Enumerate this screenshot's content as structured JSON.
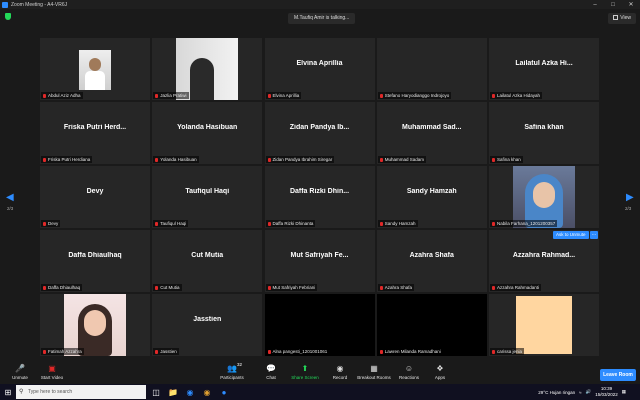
{
  "window": {
    "title": "Zoom Meeting - A4-VR6J"
  },
  "topbar": {
    "talking": "M.Taufiq Amir is talking...",
    "view_label": "View"
  },
  "nav": {
    "page_left": "2/3",
    "page_right": "2/3"
  },
  "participants": [
    {
      "label": "Abdul Aziz Adha",
      "video": "v1"
    },
    {
      "label": "Jazlia Pratiwi",
      "video": "v2"
    },
    {
      "big": "Elvina Aprillia",
      "label": "Elvina Aprillia"
    },
    {
      "big": "",
      "label": "Stefano Haryodianggo Indrojoyo"
    },
    {
      "big": "Lailatul Azka Hi...",
      "label": "Lailatul Azka Hidayah"
    },
    {
      "big": "Friska Putri Herd...",
      "label": "Friska Putri Herdiana"
    },
    {
      "big": "Yolanda Hasibuan",
      "label": "Yolanda Hasibuan"
    },
    {
      "big": "Zidan Pandya Ib...",
      "label": "Zidan Pandya Ibrahim Siregar"
    },
    {
      "big": "Muhammad Sad...",
      "label": "Muhammad Sadam"
    },
    {
      "big": "Safina khan",
      "label": "Safina khan"
    },
    {
      "big": "Devy",
      "label": "Devy"
    },
    {
      "big": "Taufiqul Haqi",
      "label": "Taufiqul Haqi"
    },
    {
      "big": "Daffa Rizki Dhin...",
      "label": "Daffa Rizki Dhinanta"
    },
    {
      "big": "Sandy Hamzah",
      "label": "Sandy Hamzah"
    },
    {
      "label": "Nabila Farhana_1201200357",
      "video": "v3"
    },
    {
      "big": "Daffa Dhiaulhaq",
      "label": "Daffa Dhiaulhaq"
    },
    {
      "big": "Cut Mutia",
      "label": "Cut Mutia"
    },
    {
      "big": "Mut Safriyah Fe...",
      "label": "Mut Safriyah Febriani"
    },
    {
      "big": "Azahra Shafa",
      "label": "Azahra Shafa"
    },
    {
      "big": "Azzahra Rahmad...",
      "label": "Azzahra Rahmadanti"
    },
    {
      "label": "Fatimah Azzahra",
      "video": "v4"
    },
    {
      "big": "Jasstien",
      "label": "Jasstien"
    },
    {
      "label": "Alna pangesti_1201001061",
      "black": true
    },
    {
      "label": "Lawren Milanda Ramadhani",
      "black": true
    },
    {
      "label": "carissa jenia",
      "peach": true
    }
  ],
  "ask_unmute": "Ask to Unmute",
  "more": "...",
  "toolbar": {
    "unmute": "Unmute",
    "start_video": "Start Video",
    "participants": "Participants",
    "participants_count": "32",
    "chat": "Chat",
    "share_screen": "Share Screen",
    "record": "Record",
    "breakout": "Breakout Rooms",
    "reactions": "Reactions",
    "apps": "Apps",
    "leave": "Leave Room"
  },
  "taskbar": {
    "search_placeholder": "Type here to search",
    "weather": "29°C Hujan ringan",
    "time": "10:39",
    "date": "15/03/2022"
  },
  "colors": {
    "accent": "#2d8cff",
    "mute_red": "#e02828",
    "share_green": "#23d959"
  }
}
